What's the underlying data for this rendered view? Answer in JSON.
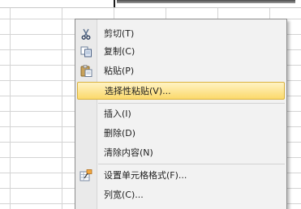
{
  "context_menu": {
    "items": [
      {
        "label": "剪切(T)",
        "icon": "scissors-icon"
      },
      {
        "label": "复制(C)",
        "icon": "copy-icon"
      },
      {
        "label": "粘贴(P)",
        "icon": "paste-icon"
      },
      {
        "label": "选择性粘贴(V)...",
        "icon": "",
        "highlighted": true
      },
      {
        "label": "插入(I)",
        "icon": ""
      },
      {
        "label": "删除(D)",
        "icon": ""
      },
      {
        "label": "清除内容(N)",
        "icon": ""
      },
      {
        "label": "设置单元格格式(F)...",
        "icon": "format-cells-icon"
      },
      {
        "label": "列宽(C)...",
        "icon": ""
      }
    ]
  },
  "colors": {
    "highlight_top": "#fff3c4",
    "highlight_bottom": "#fbd96b",
    "menu_bg": "#f2f2f2"
  }
}
